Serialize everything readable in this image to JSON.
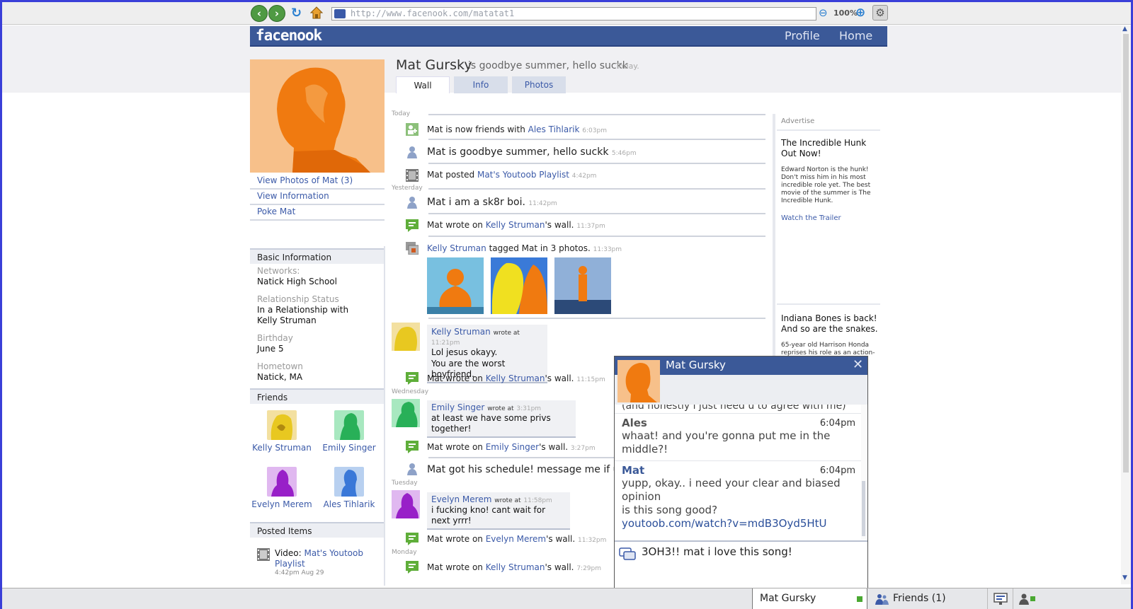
{
  "browser": {
    "url": "http://www.facenook.com/matatat1",
    "zoom": "100%"
  },
  "header": {
    "logo": "facenook",
    "nav_profile": "Profile",
    "nav_home": "Home"
  },
  "profile": {
    "name": "Mat Gursky",
    "status": "is goodbye summer, hello suckk",
    "status_time": "Today.",
    "tabs": [
      "Wall",
      "Info",
      "Photos"
    ]
  },
  "left": {
    "links": [
      "View Photos of Mat (3)",
      "View Information",
      "Poke Mat"
    ],
    "basic_info_title": "Basic Information",
    "info": [
      {
        "label": "Networks:",
        "value": "Natick High School",
        "value_link": ""
      },
      {
        "label": "Relationship Status",
        "value": "In a Relationship with",
        "value_link": "Kelly Struman"
      },
      {
        "label": "Birthday",
        "value": "June 5",
        "value_link": ""
      },
      {
        "label": "Hometown",
        "value": "Natick, MA",
        "value_link": ""
      }
    ],
    "friends_title": "Friends",
    "friends": [
      "Kelly Struman",
      "Emily Singer",
      "Evelyn Merem",
      "Ales Tihlarik"
    ],
    "posted_title": "Posted Items",
    "posted": {
      "prefix": "Video:",
      "link": "Mat's Youtoob Playlist",
      "time": "4:42pm Aug 29"
    }
  },
  "feed": {
    "days": [
      "Today",
      "Yesterday",
      "Wednesday",
      "Tuesday",
      "Monday"
    ],
    "items": [
      {
        "pre": "Mat is now friends with ",
        "link": "Ales Tihlarik",
        "post": "",
        "time": "6:03pm"
      },
      {
        "pre": "Mat is goodbye summer, hello suckk",
        "link": "",
        "post": "",
        "time": "5:46pm"
      },
      {
        "pre": "Mat posted ",
        "link": "Mat's Youtoob Playlist",
        "post": "",
        "time": "4:42pm"
      },
      {
        "pre": "Mat i am a sk8r boi.",
        "link": "",
        "post": "",
        "time": "11:42pm"
      },
      {
        "pre": "Mat wrote on ",
        "link": "Kelly Struman",
        "post": "'s wall.",
        "time": "11:37pm"
      },
      {
        "pre": "",
        "link": "Kelly Struman",
        "post": " tagged Mat in 3 photos.",
        "time": "11:33pm"
      },
      {
        "pre": "Mat wrote on ",
        "link": "Kelly Struman",
        "post": "'s wall.",
        "time": "11:15pm"
      },
      {
        "pre": "Mat wrote on ",
        "link": "Emily Singer",
        "post": "'s wall.",
        "time": "3:27pm"
      },
      {
        "pre": "Mat got his schedule! message me if u go",
        "link": "",
        "post": "",
        "time": ""
      },
      {
        "pre": "Mat wrote on ",
        "link": "Evelyn Merem",
        "post": "'s wall.",
        "time": "11:32pm"
      },
      {
        "pre": "Mat wrote on ",
        "link": "Kelly Struman",
        "post": "'s wall.",
        "time": "7:29pm"
      }
    ],
    "wall_posts": [
      {
        "who": "Kelly Struman",
        "wrote": "wrote at",
        "time": "11:21pm",
        "lines": [
          "Lol jesus okayy.",
          "You are the worst boyfriend."
        ]
      },
      {
        "who": "Emily Singer",
        "wrote": "wrote at",
        "time": "3:31pm",
        "lines": [
          "at least we have some privs together!"
        ]
      },
      {
        "who": "Evelyn Merem",
        "wrote": "wrote at",
        "time": "11:58pm",
        "lines": [
          "i fucking kno! cant wait for next yrrr!"
        ]
      }
    ]
  },
  "ads": {
    "label": "Advertise",
    "ad1": {
      "title": "The Incredible Hunk Out Now!",
      "body": "Edward Norton is the hunk! Don't miss him in his most incredible role yet. The best movie of the summer is The Incredible Hunk.",
      "link": "Watch the Trailer"
    },
    "ad2": {
      "title": "Indiana Bones is back! And so are the snakes.",
      "body": "65-year old Harrison Honda reprises his role as an action-"
    }
  },
  "chat": {
    "title": "Mat Gursky",
    "cut_line": "(and honestly i just need u to agree with me)",
    "messages": [
      {
        "from": "Ales",
        "time": "6:04pm",
        "lines": [
          "whaat! and you're gonna put me in the",
          "middle?!"
        ],
        "link": ""
      },
      {
        "from": "Mat",
        "time": "6:04pm",
        "lines": [
          "yupp, okay.. i need your clear and biased",
          "opinion",
          "is this song good?"
        ],
        "link": "youtoob.com/watch?v=mdB3Oyd5HtU"
      }
    ],
    "input_value": "3OH3!! mat i love this song!"
  },
  "bottom": {
    "chat_tab": "Mat Gursky",
    "friends": "Friends (1)"
  },
  "colors": {
    "brand": "#3b5998",
    "link": "#3b5aa8",
    "online": "#4aa832",
    "frame": "#3a3fd8"
  }
}
